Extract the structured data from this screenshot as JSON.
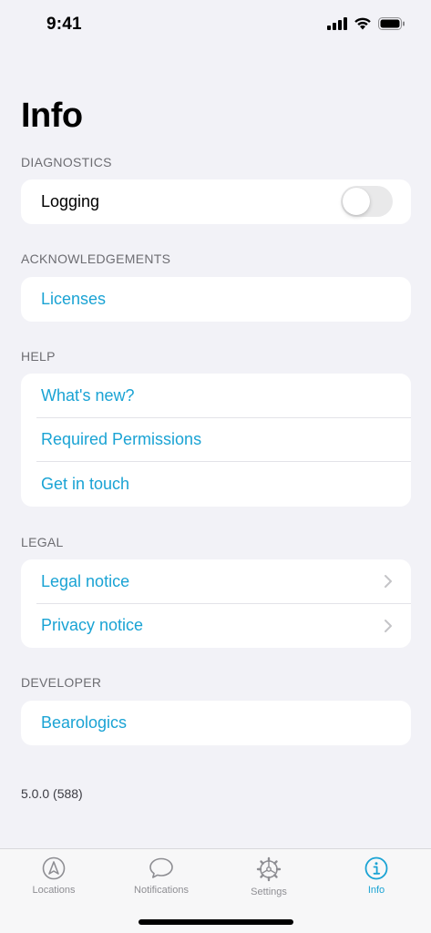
{
  "status_bar": {
    "time": "9:41"
  },
  "page": {
    "title": "Info"
  },
  "sections": {
    "diagnostics": {
      "header": "DIAGNOSTICS",
      "logging_label": "Logging",
      "logging_enabled": false
    },
    "acknowledgements": {
      "header": "ACKNOWLEDGEMENTS",
      "licenses_label": "Licenses"
    },
    "help": {
      "header": "HELP",
      "items": [
        "What's new?",
        "Required Permissions",
        "Get in touch"
      ]
    },
    "legal": {
      "header": "LEGAL",
      "items": [
        "Legal notice",
        "Privacy notice"
      ]
    },
    "developer": {
      "header": "DEVELOPER",
      "item": "Bearologics"
    }
  },
  "version": "5.0.0 (588)",
  "tab_bar": {
    "tabs": [
      {
        "label": "Locations",
        "icon": "location-arrow-icon",
        "active": false
      },
      {
        "label": "Notifications",
        "icon": "speech-bubble-icon",
        "active": false
      },
      {
        "label": "Settings",
        "icon": "gear-icon",
        "active": false
      },
      {
        "label": "Info",
        "icon": "info-circle-icon",
        "active": true
      }
    ]
  },
  "colors": {
    "accent": "#1aa3d4",
    "background": "#f2f2f7",
    "secondary_text": "#6d6d72"
  }
}
